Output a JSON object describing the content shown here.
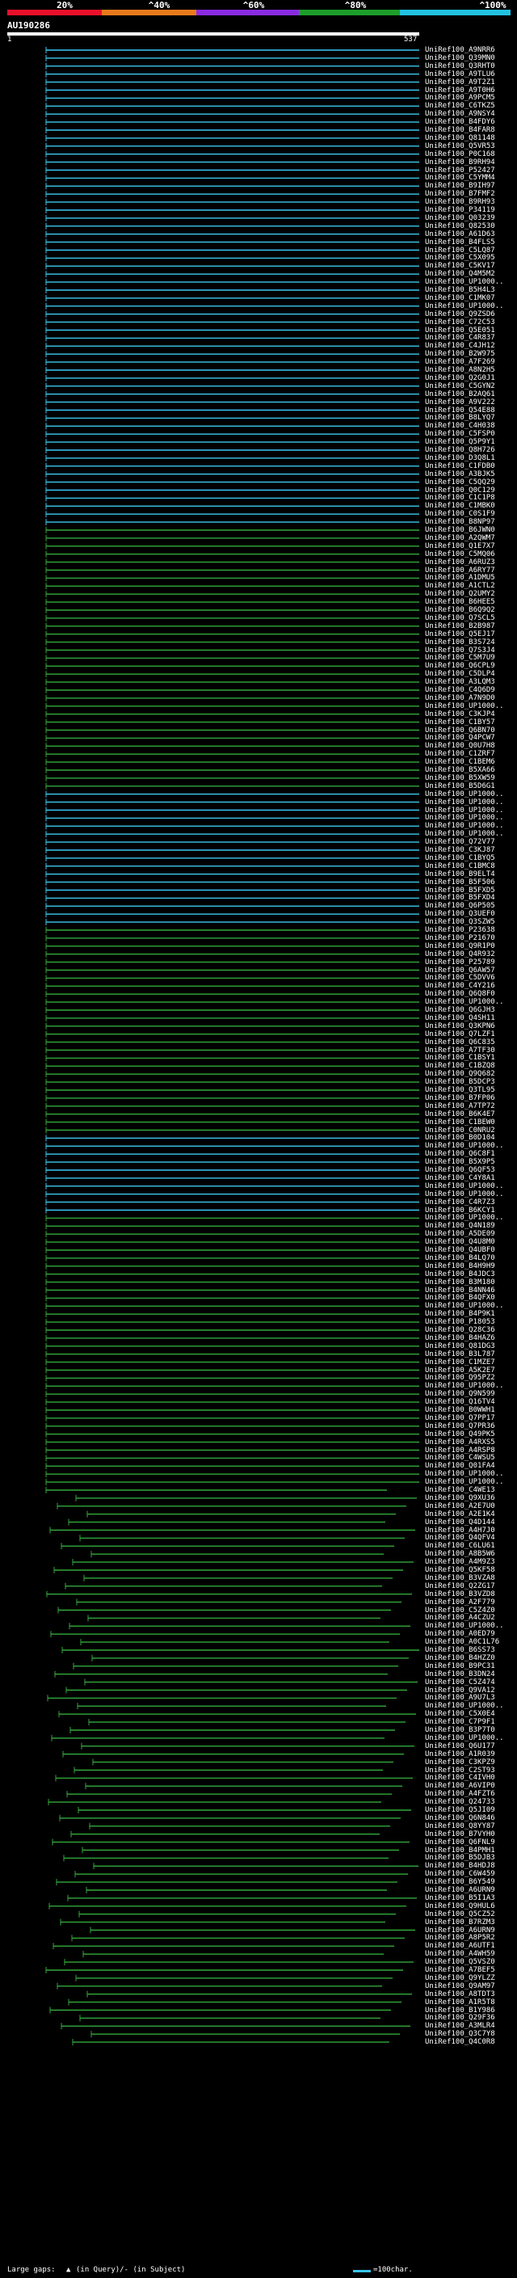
{
  "query": {
    "name": "AU190286",
    "start": "1",
    "end": "537"
  },
  "scale": [
    {
      "label": "20%",
      "color": "#e8102a"
    },
    {
      "label": "^40%",
      "color": "#e87a1c"
    },
    {
      "label": "^60%",
      "color": "#8a2be2"
    },
    {
      "label": "^80%",
      "color": "#1d9e2b"
    },
    {
      "label": "^100%",
      "color": "#22c2e0"
    }
  ],
  "colors": {
    "cyan": "#3cc8f0",
    "green": "#33a83a",
    "purple": "#c03ab8",
    "white": "#ffffff"
  },
  "legend": {
    "gap_label": "Large gaps: ",
    "gap_symbol": "▲",
    "gap_detail": "(in Query)/- (in Subject)",
    "swatch_label": "=100char."
  },
  "hits": [
    "UniRef100_A9NRR6",
    "UniRef100_Q39MN0",
    "UniRef100_Q3RHT0",
    "UniRef100_A9TLU6",
    "UniRef100_A9T2Z1",
    "UniRef100_A9T0H6",
    "UniRef100_A9PCM5",
    "UniRef100_C6TKZ5",
    "UniRef100_A9NSY4",
    "UniRef100_B4FDY6",
    "UniRef100_B4FAR8",
    "UniRef100_Q81148",
    "UniRef100_Q5VR53",
    "UniRef100_P0C168",
    "UniRef100_B9RH94",
    "UniRef100_P52427",
    "UniRef100_C5YMM4",
    "UniRef100_B9IH97",
    "UniRef100_B7FMF2",
    "UniRef100_B9RH93",
    "UniRef100_P34119",
    "UniRef100_Q03239",
    "UniRef100_Q82530",
    "UniRef100_A61D63",
    "UniRef100_B4FLS5",
    "UniRef100_C5LQ87",
    "UniRef100_C5X095",
    "UniRef100_C5KV17",
    "UniRef100_Q4M5M2",
    "UniRef100_UP1000..",
    "UniRef100_B5H4L3",
    "UniRef100_C1MK07",
    "UniRef100_UP1000..",
    "UniRef100_Q9ZSD6",
    "UniRef100_C72C53",
    "UniRef100_Q5E051",
    "UniRef100_C4R837",
    "UniRef100_C4JH12",
    "UniRef100_B2W975",
    "UniRef100_A7F269",
    "UniRef100_A8N2H5",
    "UniRef100_Q2G0J1",
    "UniRef100_C5GYN2",
    "UniRef100_B2AQ61",
    "UniRef100_A9V222",
    "UniRef100_Q54E88",
    "UniRef100_B8LYQ7",
    "UniRef100_C4H038",
    "UniRef100_C5FSP0",
    "UniRef100_Q5P9Y1",
    "UniRef100_Q8H726",
    "UniRef100_D3Q8L1",
    "UniRef100_C1FDB0",
    "UniRef100_A3BJK5",
    "UniRef100_C5QQ29",
    "UniRef100_Q0C129",
    "UniRef100_C1C1P8",
    "UniRef100_C1MBK0",
    "UniRef100_C0S1F9",
    "UniRef100_B8NP97",
    "UniRef100_B6JWN0",
    "UniRef100_A2QWM7",
    "UniRef100_Q1E7X7",
    "UniRef100_C5MQ06",
    "UniRef100_A6RUZ3",
    "UniRef100_A6RY77",
    "UniRef100_A1DMU5",
    "UniRef100_A1CTL2",
    "UniRef100_Q2UMY2",
    "UniRef100_B6HEE5",
    "UniRef100_B6Q9Q2",
    "UniRef100_Q7SCL5",
    "UniRef100_B2B987",
    "UniRef100_Q5EJ17",
    "UniRef100_B3S724",
    "UniRef100_Q7S3J4",
    "UniRef100_C5M7U9",
    "UniRef100_Q6CPL9",
    "UniRef100_C5DLP4",
    "UniRef100_A3LQM3",
    "UniRef100_C4Q6D9",
    "UniRef100_A7N9D0",
    "UniRef100_UP1000..",
    "UniRef100_C3KJP4",
    "UniRef100_C1BY57",
    "UniRef100_Q6BN70",
    "UniRef100_Q4PCW7",
    "UniRef100_Q0U7H8",
    "UniRef100_C1ZRF7",
    "UniRef100_C1BEM6",
    "UniRef100_B5XA66",
    "UniRef100_B5XW59",
    "UniRef100_B5D6G1",
    "UniRef100_UP1000..",
    "UniRef100_UP1000..",
    "UniRef100_UP1000..",
    "UniRef100_UP1000..",
    "UniRef100_UP1000..",
    "UniRef100_UP1000..",
    "UniRef100_Q72V77",
    "UniRef100_C3KJ87",
    "UniRef100_C1BYQ5",
    "UniRef100_C1BMC8",
    "UniRef100_B9ELT4",
    "UniRef100_B5F506",
    "UniRef100_B5FXD5",
    "UniRef100_B5FXD4",
    "UniRef100_Q6P505",
    "UniRef100_Q3UEF0",
    "UniRef100_Q3SZW5",
    "UniRef100_P23638",
    "UniRef100_P21670",
    "UniRef100_Q9R1P0",
    "UniRef100_Q4R932",
    "UniRef100_P25789",
    "UniRef100_Q6AW57",
    "UniRef100_C5DVV6",
    "UniRef100_C4Y216",
    "UniRef100_Q6Q8F0",
    "UniRef100_UP1000..",
    "UniRef100_Q6GJH3",
    "UniRef100_Q4SH11",
    "UniRef100_Q3KPN6",
    "UniRef100_Q7LZF1",
    "UniRef100_Q6C835",
    "UniRef100_A7TF30",
    "UniRef100_C1BSY1",
    "UniRef100_C1BZQ8",
    "UniRef100_Q9Q682",
    "UniRef100_B5DCP3",
    "UniRef100_Q3TL95",
    "UniRef100_B7FP06",
    "UniRef100_A7TP72",
    "UniRef100_B6K4E7",
    "UniRef100_C1BEW0",
    "UniRef100_C0NRU2",
    "UniRef100_B0D104",
    "UniRef100_UP1000..",
    "UniRef100_Q6C8F1",
    "UniRef100_B5X9P5",
    "UniRef100_Q6QF53",
    "UniRef100_C4Y8A1",
    "UniRef100_UP1000..",
    "UniRef100_UP1000..",
    "UniRef100_C4R7Z3",
    "UniRef100_B6KCY1",
    "UniRef100_UP1000..",
    "UniRef100_Q4N189",
    "UniRef100_A5DE09",
    "UniRef100_Q4U8M0",
    "UniRef100_Q4UBF0",
    "UniRef100_B4LQ70",
    "UniRef100_B4H9H9",
    "UniRef100_B4JDC3",
    "UniRef100_B3M180",
    "UniRef100_B4NN46",
    "UniRef100_B4QFX0",
    "UniRef100_UP1000..",
    "UniRef100_B4P9K1",
    "UniRef100_P18053",
    "UniRef100_Q28C36",
    "UniRef100_B4HAZ6",
    "UniRef100_Q81DG3",
    "UniRef100_B3L787",
    "UniRef100_C1MZE7",
    "UniRef100_A5K2E7",
    "UniRef100_Q95PZ2",
    "UniRef100_UP1000..",
    "UniRef100_Q9N599",
    "UniRef100_Q16TV4",
    "UniRef100_B0WWH1",
    "UniRef100_Q7PP17",
    "UniRef100_Q7PR36",
    "UniRef100_Q49PK5",
    "UniRef100_A4RXS5",
    "UniRef100_A4RSP8",
    "UniRef100_C4WSU5",
    "UniRef100_Q01FA4",
    "UniRef100_UP1000..",
    "UniRef100_UP1000..",
    "UniRef100_C4WE13",
    "UniRef100_Q9XU36",
    "UniRef100_A2E7U0",
    "UniRef100_A2E1K4",
    "UniRef100_Q4D144",
    "UniRef100_A4H7J0",
    "UniRef100_Q4QFV4",
    "UniRef100_C6LU61",
    "UniRef100_A8B5W6",
    "UniRef100_A4M9Z3",
    "UniRef100_Q5KF58",
    "UniRef100_B3VZA8",
    "UniRef100_Q2ZG17",
    "UniRef100_B3VZD8",
    "UniRef100_A2F779",
    "UniRef100_C5Z4Z0",
    "UniRef100_A4CZU2",
    "UniRef100_UP1000..",
    "UniRef100_A0ED79",
    "UniRef100_A0C1L76",
    "UniRef100_B6SS73",
    "UniRef100_B4HZZ0",
    "UniRef100_B9PC31",
    "UniRef100_B3DN24",
    "UniRef100_C5Z474",
    "UniRef100_Q9VA12",
    "UniRef100_A9U7L3",
    "UniRef100_UP1000..",
    "UniRef100_C5X0E4",
    "UniRef100_C7P9F1",
    "UniRef100_B3P7T0",
    "UniRef100_UP1000..",
    "UniRef100_Q6U177",
    "UniRef100_A1R039",
    "UniRef100_C3KPZ9",
    "UniRef100_C2ST93",
    "UniRef100_C4IVH0",
    "UniRef100_A6VIP0",
    "UniRef100_A4FZT6",
    "UniRef100_Q24733",
    "UniRef100_Q5JI09",
    "UniRef100_Q6N846",
    "UniRef100_Q8YY87",
    "UniRef100_B7VYH0",
    "UniRef100_Q6FNL9",
    "UniRef100_B4PMH1",
    "UniRef100_B5DJB3",
    "UniRef100_B4HDJ8",
    "UniRef100_C6W459",
    "UniRef100_B6Y549",
    "UniRef100_A6URN9",
    "UniRef100_B5I1A3",
    "UniRef100_Q9HUL6",
    "UniRef100_Q5CZ52",
    "UniRef100_B7RZM3",
    "UniRef100_A6URN9",
    "UniRef100_A8P5R2",
    "UniRef100_A6UTF1",
    "UniRef100_A4WH59",
    "UniRef100_Q5VSZ0",
    "UniRef100_A7BEF5",
    "UniRef100_Q9YLZZ",
    "UniRef100_Q9AM97",
    "UniRef100_A8TDT3",
    "UniRef100_A1R5T8",
    "UniRef100_B1Y986",
    "UniRef100_Q29F36",
    "UniRef100_A3MLR4",
    "UniRef100_Q3C7Y8",
    "UniRef100_Q4C0R8"
  ]
}
